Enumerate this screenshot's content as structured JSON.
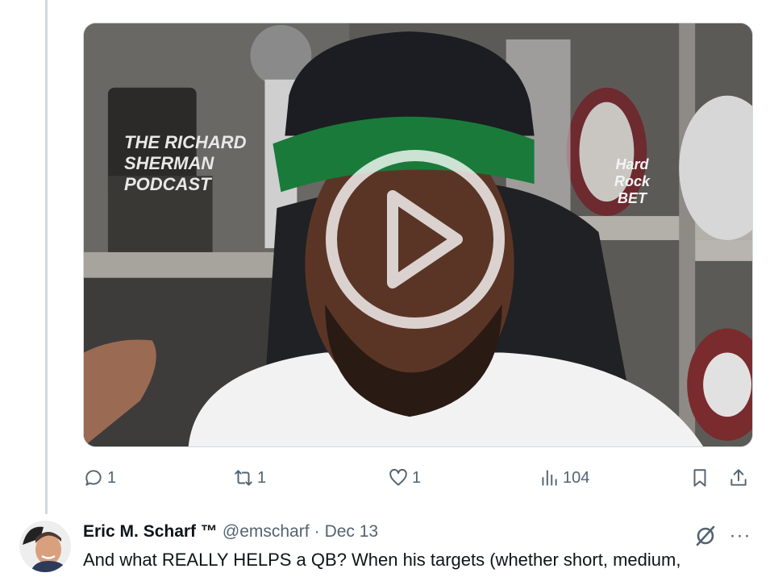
{
  "video": {
    "overlay_text_1": "THE RICHARD SHERMAN PODCAST",
    "overlay_text_2": "Hard Rock BET",
    "play_icon": "play-icon"
  },
  "actions": {
    "reply_count": "1",
    "repost_count": "1",
    "like_count": "1",
    "views_count": "104"
  },
  "tweet2": {
    "name": "Eric M. Scharf ™",
    "handle": "@emscharf",
    "separator": "·",
    "date": "Dec 13",
    "text": "And what REALLY HELPS a QB? When his targets (whether short, medium,",
    "more_label": "···"
  },
  "colors": {
    "muted": "#536471",
    "text": "#0f1419",
    "thread_line": "#cfd9de"
  }
}
